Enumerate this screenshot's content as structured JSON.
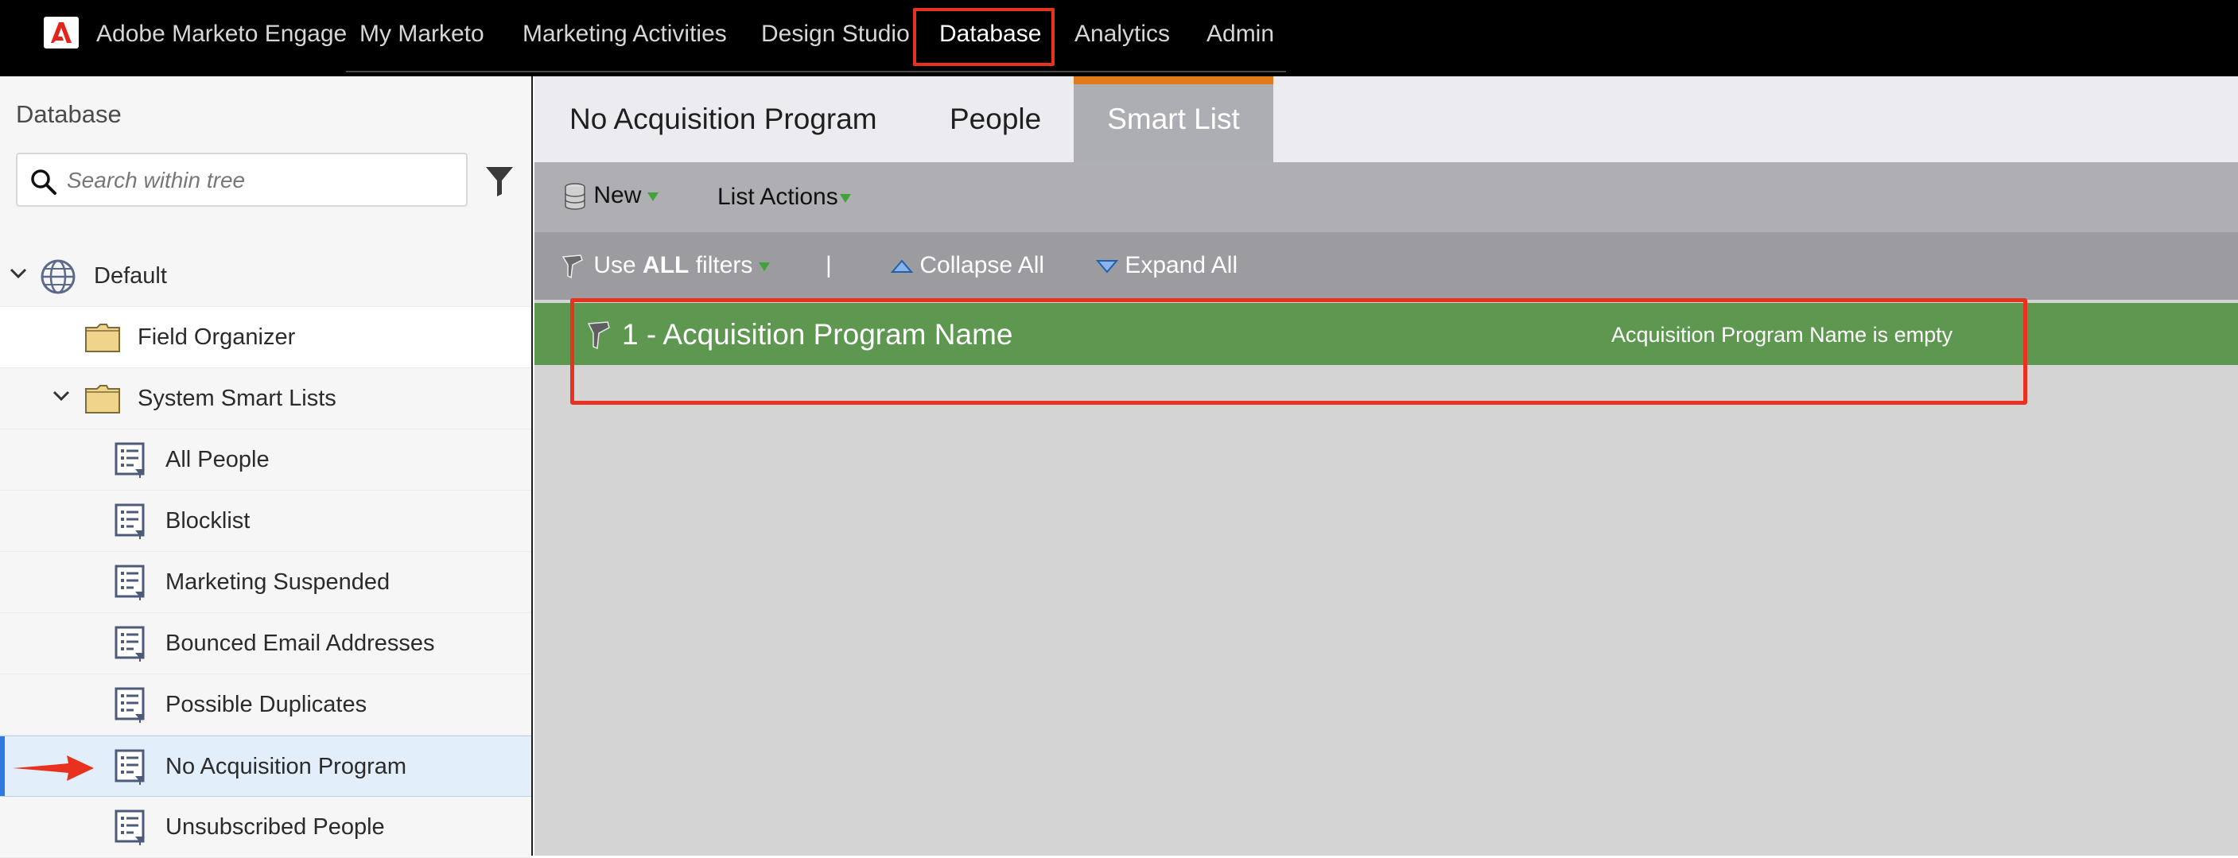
{
  "app": {
    "brand": "Adobe Marketo Engage"
  },
  "nav": {
    "items": [
      {
        "label": "My Marketo"
      },
      {
        "label": "Marketing Activities"
      },
      {
        "label": "Design Studio"
      },
      {
        "label": "Database"
      },
      {
        "label": "Analytics"
      },
      {
        "label": "Admin"
      }
    ],
    "active": "Database"
  },
  "sidebar": {
    "title": "Database",
    "search_placeholder": "Search within tree",
    "tree": [
      {
        "label": "Default",
        "icon": "globe-icon"
      },
      {
        "label": "Field Organizer",
        "icon": "folder-icon"
      },
      {
        "label": "System Smart Lists",
        "icon": "folder-icon"
      },
      {
        "label": "All People",
        "icon": "smart-list-icon"
      },
      {
        "label": "Blocklist",
        "icon": "smart-list-icon"
      },
      {
        "label": "Marketing Suspended",
        "icon": "smart-list-icon"
      },
      {
        "label": "Bounced Email Addresses",
        "icon": "smart-list-icon"
      },
      {
        "label": "Possible Duplicates",
        "icon": "smart-list-icon"
      },
      {
        "label": "No Acquisition Program",
        "icon": "smart-list-icon",
        "selected": true
      },
      {
        "label": "Unsubscribed People",
        "icon": "smart-list-icon"
      }
    ]
  },
  "main": {
    "tabs": [
      {
        "label": "No Acquisition Program"
      },
      {
        "label": "People"
      },
      {
        "label": "Smart List"
      }
    ],
    "active_tab": "Smart List",
    "toolbar": {
      "new_label": "New",
      "list_actions_label": "List Actions"
    },
    "filter_toolbar": {
      "use_prefix": "Use",
      "use_bold": "ALL",
      "use_suffix": "filters",
      "separator": "|",
      "collapse_all": "Collapse All",
      "expand_all": "Expand All"
    },
    "filters": [
      {
        "name": "1 - Acquisition Program Name",
        "description": "Acquisition Program Name is empty"
      }
    ]
  },
  "colors": {
    "accent_orange": "#e07a1a",
    "filter_green": "#5e9850",
    "highlight_red": "#e8321f",
    "selection_blue": "#2d7be2"
  }
}
